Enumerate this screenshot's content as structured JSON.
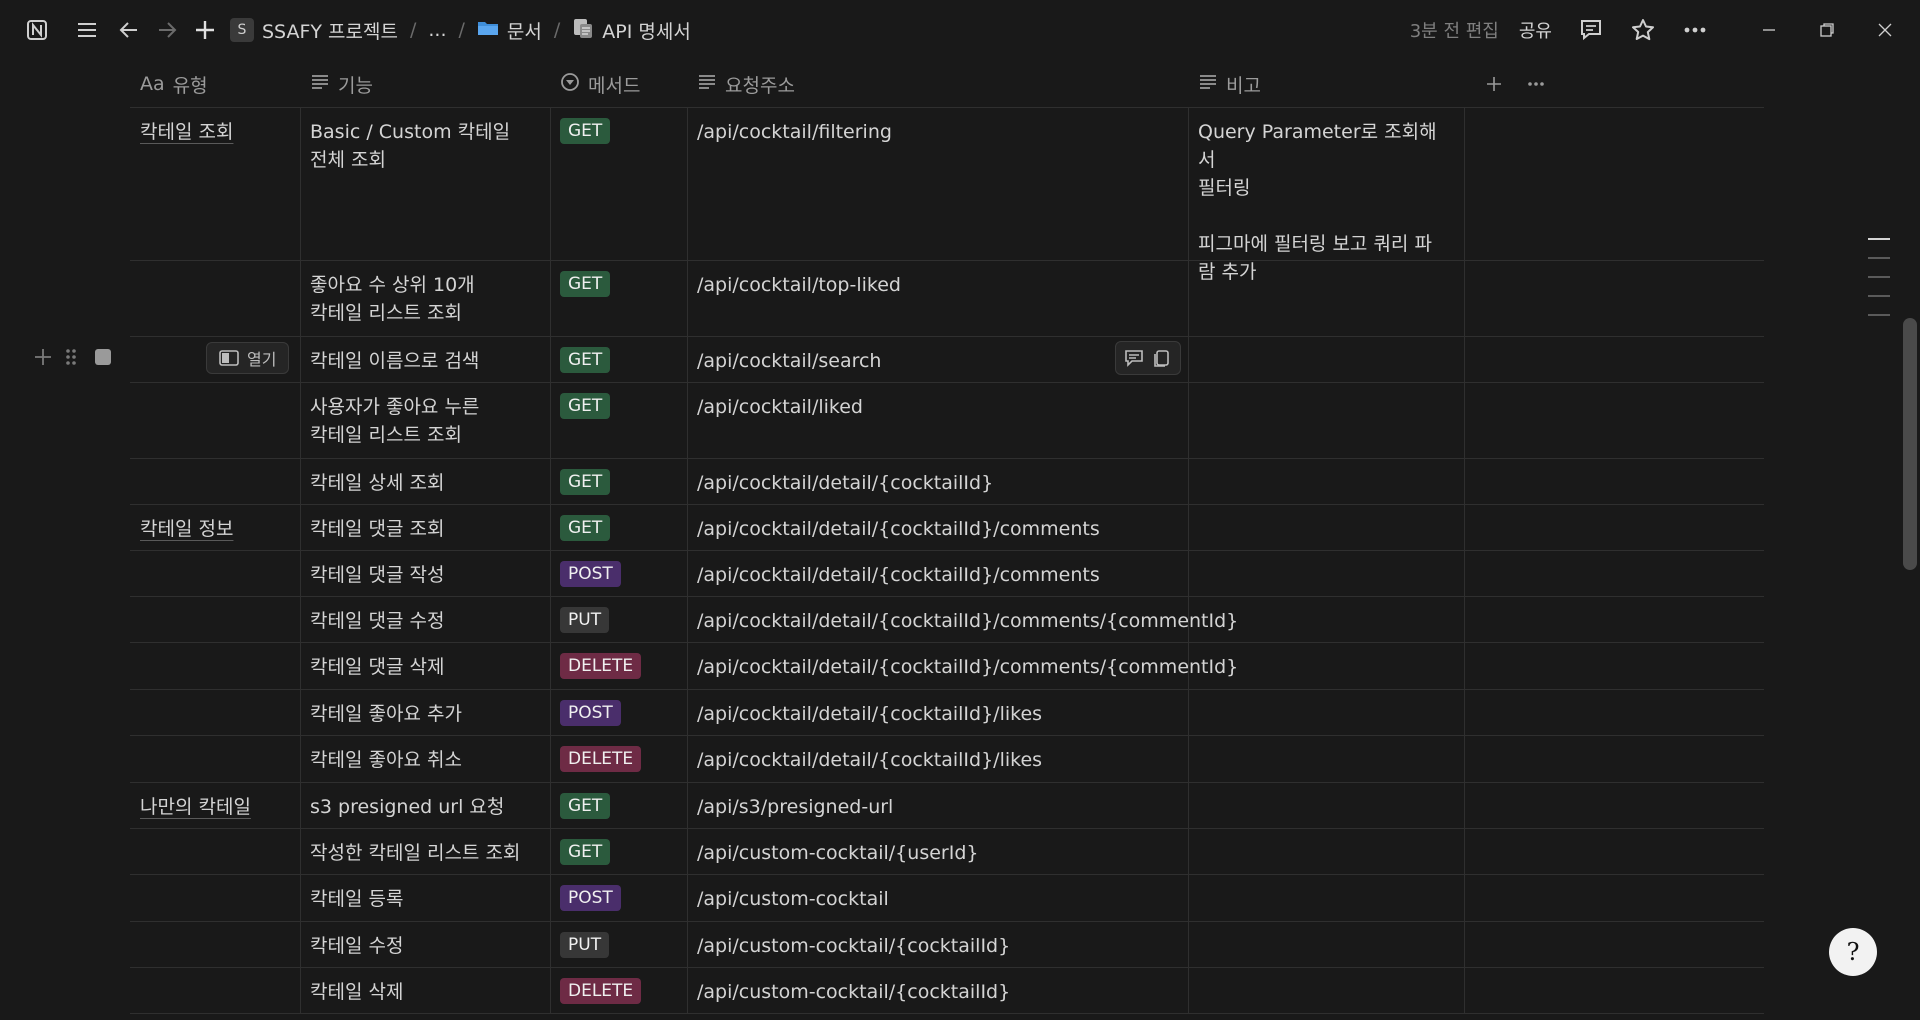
{
  "topbar": {
    "workspace_initial": "S",
    "workspace_name": "SSAFY 프로젝트",
    "ellipsis": "...",
    "folder_name": "문서",
    "page_title": "API 명세서",
    "edited": "3분 전 편집",
    "share": "공유"
  },
  "table": {
    "headers": {
      "type_prefix": "Aa",
      "type": "유형",
      "function": "기능",
      "method": "메서드",
      "url": "요청주소",
      "note": "비고"
    },
    "open_label": "열기",
    "rows": [
      {
        "type": "칵테일 조회",
        "function": [
          "Basic / Custom 칵테일",
          "전체 조회"
        ],
        "method": "GET",
        "url": "/api/cocktail/filtering",
        "note": [
          "Query Parameter로 조회해서",
          "필터링",
          "",
          "피그마에 필터링 보고 쿼리 파",
          "람 추가"
        ]
      },
      {
        "type": "",
        "function": [
          "좋아요 수 상위 10개",
          "칵테일 리스트 조회"
        ],
        "method": "GET",
        "url": "/api/cocktail/top-liked",
        "note": []
      },
      {
        "type": "",
        "function": [
          "칵테일 이름으로 검색"
        ],
        "method": "GET",
        "url": "/api/cocktail/search",
        "note": []
      },
      {
        "type": "",
        "function": [
          "사용자가 좋아요 누른",
          "칵테일 리스트 조회"
        ],
        "method": "GET",
        "url": "/api/cocktail/liked",
        "note": []
      },
      {
        "type": "",
        "function": [
          "칵테일 상세 조회"
        ],
        "method": "GET",
        "url": "/api/cocktail/detail/{cocktailId}",
        "note": []
      },
      {
        "type": "칵테일 정보",
        "function": [
          "칵테일 댓글 조회"
        ],
        "method": "GET",
        "url": "/api/cocktail/detail/{cocktailId}/comments",
        "note": []
      },
      {
        "type": "",
        "function": [
          "칵테일 댓글 작성"
        ],
        "method": "POST",
        "url": "/api/cocktail/detail/{cocktailId}/comments",
        "note": []
      },
      {
        "type": "",
        "function": [
          "칵테일 댓글 수정"
        ],
        "method": "PUT",
        "url": "/api/cocktail/detail/{cocktailId}/comments/{commentId}",
        "note": []
      },
      {
        "type": "",
        "function": [
          "칵테일 댓글 삭제"
        ],
        "method": "DELETE",
        "url": "/api/cocktail/detail/{cocktailId}/comments/{commentId}",
        "note": []
      },
      {
        "type": "",
        "function": [
          "칵테일 좋아요 추가"
        ],
        "method": "POST",
        "url": "/api/cocktail/detail/{cocktailId}/likes",
        "note": []
      },
      {
        "type": "",
        "function": [
          "칵테일 좋아요 취소"
        ],
        "method": "DELETE",
        "url": "/api/cocktail/detail/{cocktailId}/likes",
        "note": []
      },
      {
        "type": "나만의 칵테일",
        "function": [
          "s3 presigned url 요청"
        ],
        "method": "GET",
        "url": "/api/s3/presigned-url",
        "note": []
      },
      {
        "type": "",
        "function": [
          "작성한 칵테일 리스트 조회"
        ],
        "method": "GET",
        "url": "/api/custom-cocktail/{userId}",
        "note": []
      },
      {
        "type": "",
        "function": [
          "칵테일 등록"
        ],
        "method": "POST",
        "url": "/api/custom-cocktail",
        "note": []
      },
      {
        "type": "",
        "function": [
          "칵테일 수정"
        ],
        "method": "PUT",
        "url": "/api/custom-cocktail/{cocktailId}",
        "note": []
      },
      {
        "type": "",
        "function": [
          "칵테일 삭제"
        ],
        "method": "DELETE",
        "url": "/api/custom-cocktail/{cocktailId}",
        "note": []
      }
    ]
  },
  "method_colors": {
    "GET": "#2b5a3d",
    "POST": "#4a2e6b",
    "PUT": "#373737",
    "DELETE": "#6e2b45"
  },
  "help_glyph": "?"
}
